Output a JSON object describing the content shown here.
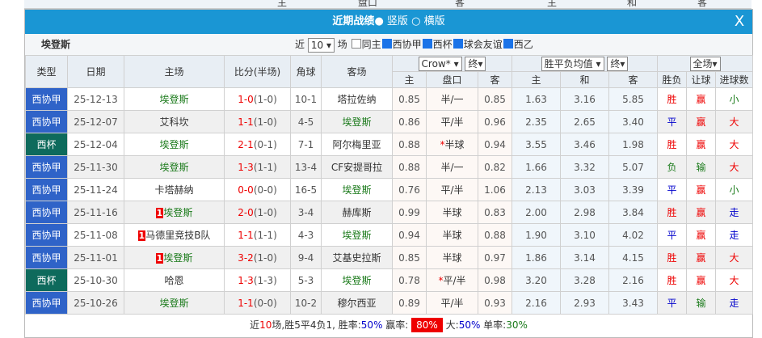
{
  "top_strip": [
    "主",
    "盘口",
    "客",
    "主",
    "和",
    "客"
  ],
  "title": {
    "label": "近期战绩",
    "opt1": "竖版",
    "opt2": "横版",
    "close": "X"
  },
  "filter": {
    "team": "埃登斯",
    "near": "近",
    "count": "10",
    "unit": "场",
    "checks": [
      {
        "label": "同主",
        "on": false
      },
      {
        "label": "西协甲",
        "on": true
      },
      {
        "label": "西杯",
        "on": true
      },
      {
        "label": "球会友谊",
        "on": true
      },
      {
        "label": "西乙",
        "on": true
      }
    ]
  },
  "headers": {
    "type": "类型",
    "date": "日期",
    "home": "主场",
    "score": "比分(半场)",
    "corner": "角球",
    "away": "客场",
    "company": "Crow*",
    "final1": "终",
    "eu": "胜平负均值",
    "final2": "终",
    "scope": "全场",
    "sub": [
      "主",
      "盘口",
      "客",
      "主",
      "和",
      "客",
      "胜负",
      "让球",
      "进球数"
    ]
  },
  "colors": {
    "西协甲": "#2f63c8",
    "西杯": "#0e6a5c",
    "title": "#1a96d4"
  },
  "focus_team": "埃登斯",
  "rows": [
    {
      "type": "西协甲",
      "date": "25-12-13",
      "home": "埃登斯",
      "hrc": "",
      "score": "1-0",
      "half": "(1-0)",
      "corner": "10-1",
      "away": "塔拉佐纳",
      "arc": "",
      "o1": "0.85",
      "hc": "半/一",
      "o2": "0.85",
      "e1": "1.63",
      "e2": "3.16",
      "e3": "5.85",
      "wl": "胜",
      "ah": "赢",
      "ou": "小"
    },
    {
      "type": "西协甲",
      "date": "25-12-07",
      "home": "艾科坎",
      "hrc": "",
      "score": "1-1",
      "half": "(1-0)",
      "corner": "4-5",
      "away": "埃登斯",
      "o1": "0.86",
      "hc": "平/半",
      "o2": "0.96",
      "e1": "2.35",
      "e2": "2.65",
      "e3": "3.40",
      "wl": "平",
      "ah": "赢",
      "ou": "大"
    },
    {
      "type": "西杯",
      "date": "25-12-04",
      "home": "埃登斯",
      "hrc": "",
      "score": "2-1",
      "half": "(0-1)",
      "corner": "7-1",
      "away": "阿尔梅里亚",
      "o1": "0.88",
      "hc": "*半球",
      "o2": "0.94",
      "e1": "3.55",
      "e2": "3.46",
      "e3": "1.98",
      "wl": "胜",
      "ah": "赢",
      "ou": "大"
    },
    {
      "type": "西协甲",
      "date": "25-11-30",
      "home": "埃登斯",
      "hrc": "",
      "score": "1-3",
      "half": "(1-1)",
      "corner": "13-4",
      "away": "CF安提哥拉",
      "o1": "0.88",
      "hc": "半/一",
      "o2": "0.82",
      "e1": "1.66",
      "e2": "3.32",
      "e3": "5.07",
      "wl": "负",
      "ah": "输",
      "ou": "大"
    },
    {
      "type": "西协甲",
      "date": "25-11-24",
      "home": "卡塔赫纳",
      "hrc": "",
      "score": "0-0",
      "half": "(0-0)",
      "corner": "16-5",
      "away": "埃登斯",
      "o1": "0.76",
      "hc": "平/半",
      "o2": "1.06",
      "e1": "2.13",
      "e2": "3.03",
      "e3": "3.39",
      "wl": "平",
      "ah": "赢",
      "ou": "小"
    },
    {
      "type": "西协甲",
      "date": "25-11-16",
      "home": "埃登斯",
      "hrc": "1",
      "score": "2-0",
      "half": "(1-0)",
      "corner": "3-4",
      "away": "赫库斯",
      "o1": "0.99",
      "hc": "半球",
      "o2": "0.83",
      "e1": "2.00",
      "e2": "2.98",
      "e3": "3.84",
      "wl": "胜",
      "ah": "赢",
      "ou": "走"
    },
    {
      "type": "西协甲",
      "date": "25-11-08",
      "home": "马德里竞技B队",
      "hrc": "1",
      "score": "1-1",
      "half": "(1-1)",
      "corner": "4-3",
      "away": "埃登斯",
      "o1": "0.94",
      "hc": "半球",
      "o2": "0.88",
      "e1": "1.90",
      "e2": "3.10",
      "e3": "4.02",
      "wl": "平",
      "ah": "赢",
      "ou": "走"
    },
    {
      "type": "西协甲",
      "date": "25-11-01",
      "home": "埃登斯",
      "hrc": "1",
      "score": "3-2",
      "half": "(1-0)",
      "corner": "9-4",
      "away": "艾基史拉斯",
      "o1": "0.85",
      "hc": "半球",
      "o2": "0.97",
      "e1": "1.86",
      "e2": "3.14",
      "e3": "4.15",
      "wl": "胜",
      "ah": "赢",
      "ou": "大"
    },
    {
      "type": "西杯",
      "date": "25-10-30",
      "home": "哈恩",
      "hrc": "",
      "score": "1-3",
      "half": "(1-3)",
      "corner": "5-3",
      "away": "埃登斯",
      "o1": "0.78",
      "hc": "*平/半",
      "o2": "0.98",
      "e1": "3.20",
      "e2": "3.28",
      "e3": "2.16",
      "wl": "胜",
      "ah": "赢",
      "ou": "大"
    },
    {
      "type": "西协甲",
      "date": "25-10-26",
      "home": "埃登斯",
      "hrc": "",
      "score": "1-1",
      "half": "(0-0)",
      "corner": "10-2",
      "away": "穆尔西亚",
      "o1": "0.89",
      "hc": "平/半",
      "o2": "0.93",
      "e1": "2.16",
      "e2": "2.93",
      "e3": "3.43",
      "wl": "平",
      "ah": "输",
      "ou": "走"
    }
  ],
  "footer": {
    "p1": "近",
    "n": "10",
    "p2": "场,胜5平4负1, 胜率:",
    "win": "50%",
    "p3": " 赢率: ",
    "ah": "80%",
    "p4": " 大:",
    "big": "50%",
    "p5": " 单率:",
    "odd": "30%"
  }
}
